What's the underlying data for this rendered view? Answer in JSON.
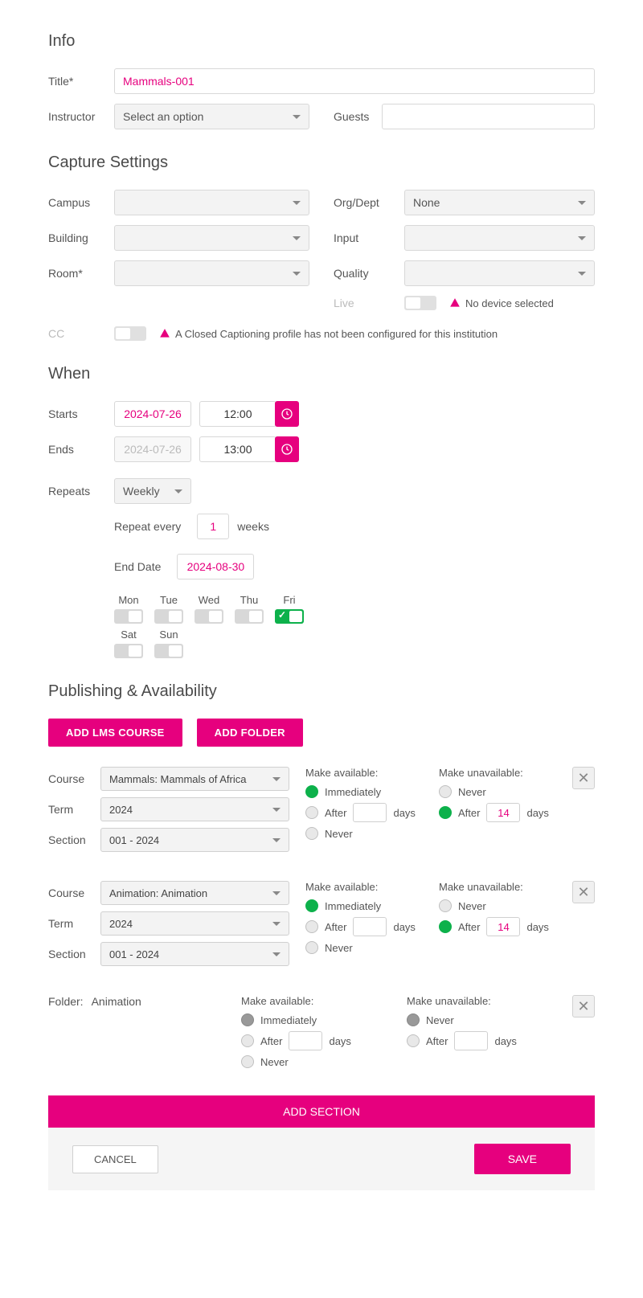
{
  "headings": {
    "info": "Info",
    "capture": "Capture Settings",
    "when": "When",
    "pub": "Publishing & Availability"
  },
  "info": {
    "title_label": "Title*",
    "title_value": "Mammals-001",
    "instructor_label": "Instructor",
    "instructor_value": "Select an option",
    "guests_label": "Guests",
    "guests_value": ""
  },
  "capture": {
    "campus_label": "Campus",
    "campus_value": "",
    "building_label": "Building",
    "building_value": "",
    "room_label": "Room*",
    "room_value": "",
    "orgdept_label": "Org/Dept",
    "orgdept_value": "None",
    "input_label": "Input",
    "input_value": "",
    "quality_label": "Quality",
    "quality_value": "",
    "live_label": "Live",
    "live_warn": "No device selected",
    "cc_label": "CC",
    "cc_warn": "A Closed Captioning profile has not been configured for this institution"
  },
  "when": {
    "starts_label": "Starts",
    "start_date": "2024-07-26",
    "start_time": "12:00",
    "ends_label": "Ends",
    "end_date": "2024-07-26",
    "end_time": "13:00",
    "repeats_label": "Repeats",
    "repeats_value": "Weekly",
    "repeat_every_label": "Repeat every",
    "repeat_every_value": "1",
    "repeat_unit": "weeks",
    "enddate_label": "End Date",
    "enddate_value": "2024-08-30",
    "days": {
      "mon": "Mon",
      "tue": "Tue",
      "wed": "Wed",
      "thu": "Thu",
      "fri": "Fri",
      "sat": "Sat",
      "sun": "Sun"
    }
  },
  "pub": {
    "add_lms": "ADD LMS COURSE",
    "add_folder": "ADD FOLDER",
    "course_label": "Course",
    "term_label": "Term",
    "section_label": "Section",
    "make_avail": "Make available:",
    "make_unavail": "Make unavailable:",
    "immediately": "Immediately",
    "after": "After",
    "days": "days",
    "never": "Never",
    "folder_label": "Folder:",
    "entries": [
      {
        "course": "Mammals: Mammals of Africa",
        "term": "2024",
        "section": "001 - 2024",
        "unavail_after": "14"
      },
      {
        "course": "Animation: Animation",
        "term": "2024",
        "section": "001 - 2024",
        "unavail_after": "14"
      }
    ],
    "folder_name": "Animation"
  },
  "footer": {
    "add_section": "ADD SECTION",
    "cancel": "CANCEL",
    "save": "SAVE"
  }
}
